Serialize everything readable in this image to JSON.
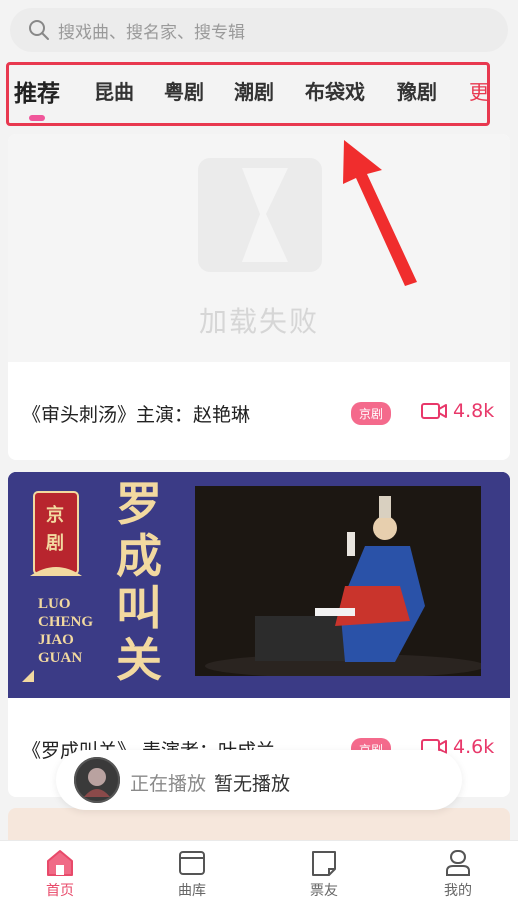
{
  "search": {
    "placeholder": "搜戏曲、搜名家、搜专辑"
  },
  "tabs": [
    {
      "label": "推荐",
      "active": true
    },
    {
      "label": "昆曲"
    },
    {
      "label": "粤剧"
    },
    {
      "label": "潮剧"
    },
    {
      "label": "布袋戏"
    },
    {
      "label": "豫剧"
    },
    {
      "label": "更多"
    }
  ],
  "cards": [
    {
      "image_status": "加载失败",
      "title": "《审头刺汤》主演：赵艳琳",
      "genre": "京剧",
      "views": "4.8k"
    },
    {
      "poster": {
        "badge": "京剧",
        "title_cn": "罗成叫关",
        "title_pinyin": [
          "LUO",
          "CHENG",
          "JIAO",
          "GUAN"
        ]
      },
      "title": "《罗成叫关》 表演者：叶成兰",
      "genre": "京剧",
      "views": "4.6k"
    }
  ],
  "player": {
    "status": "正在播放",
    "track": "暂无播放"
  },
  "bottom_nav": [
    {
      "label": "首页",
      "icon": "home-icon",
      "active": true
    },
    {
      "label": "曲库",
      "icon": "library-icon"
    },
    {
      "label": "票友",
      "icon": "community-icon"
    },
    {
      "label": "我的",
      "icon": "profile-icon"
    }
  ],
  "colors": {
    "accent": "#e8384f",
    "pink": "#f0569a",
    "poster_bg": "#3b3b86",
    "gold": "#f2d9a0"
  }
}
